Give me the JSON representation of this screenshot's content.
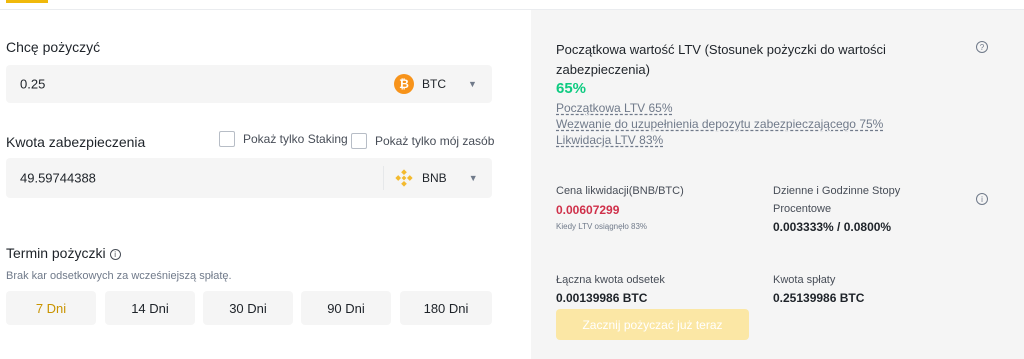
{
  "borrow": {
    "label": "Chcę pożyczyć",
    "amount": "0.25",
    "asset": "BTC",
    "asset_icon": "bitcoin-icon"
  },
  "collateral": {
    "label": "Kwota zabezpieczenia",
    "staking_only_label": "Pokaż tylko Staking",
    "my_assets_only_label": "Pokaż tylko mój zasób",
    "amount": "49.59744388",
    "asset": "BNB",
    "asset_icon": "bnb-icon"
  },
  "term": {
    "label": "Termin pożyczki",
    "note": "Brak kar odsetkowych za wcześniejszą spłatę.",
    "options": [
      "7 Dni",
      "14 Dni",
      "30 Dni",
      "90 Dni",
      "180 Dni"
    ],
    "selected": "7 Dni"
  },
  "ltv": {
    "title": "Początkowa wartość LTV (Stosunek pożyczki do wartości zabezpieczenia)",
    "value": "65%",
    "initial": "Początkowa LTV 65%",
    "margin_call": "Wezwanie do uzupełnienia depozytu zabezpieczającego 75%",
    "liquidation": "Likwidacja LTV 83%"
  },
  "stats": {
    "liq_price_label": "Cena likwidacji(BNB/BTC)",
    "liq_price_value": "0.00607299",
    "liq_price_note": "Kiedy LTV osiągnęło 83%",
    "rates_label": "Dzienne i Godzinne Stopy Procentowe",
    "rates_value": "0.003333% / 0.0800%",
    "total_interest_label": "Łączna kwota odsetek",
    "total_interest_value": "0.00139986 BTC",
    "repay_label": "Kwota spłaty",
    "repay_value": "0.25139986 BTC"
  },
  "cta": {
    "label": "Zacznij pożyczać już teraz"
  },
  "colors": {
    "accent": "#f0b90b",
    "positive": "#0ecb81",
    "negative": "#cf304a",
    "panel_bg": "#f5f5f5"
  }
}
